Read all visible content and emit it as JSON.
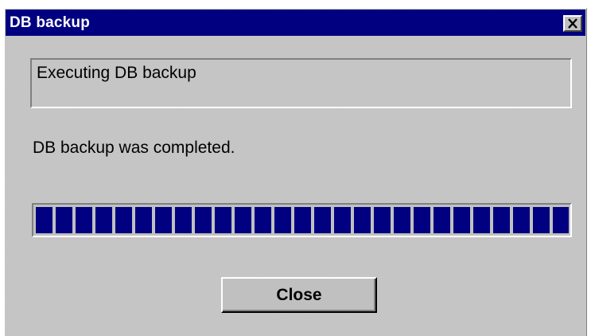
{
  "window": {
    "title": "DB backup",
    "close_icon": "close-x-icon"
  },
  "status_box": {
    "text": "Executing DB backup"
  },
  "message": "DB backup was completed.",
  "progress": {
    "percent": 100
  },
  "buttons": {
    "close_label": "Close"
  },
  "colors": {
    "titlebar": "#000080",
    "progress_fill": "#000080",
    "dialog_face": "#c0c0c0"
  }
}
